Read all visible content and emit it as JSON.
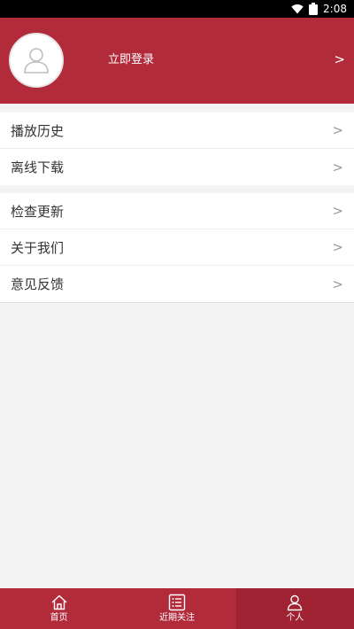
{
  "status_bar": {
    "time": "2:08"
  },
  "profile": {
    "login_label": "立即登录",
    "chevron": ">"
  },
  "menu_group_1": [
    {
      "label": "播放历史",
      "chevron": ">"
    },
    {
      "label": "离线下载",
      "chevron": ">"
    }
  ],
  "menu_group_2": [
    {
      "label": "检查更新",
      "chevron": ">"
    },
    {
      "label": "关于我们",
      "chevron": ">"
    },
    {
      "label": "意见反馈",
      "chevron": ">"
    }
  ],
  "tabs": [
    {
      "label": "首页",
      "icon": "home-icon",
      "active": false
    },
    {
      "label": "近期关注",
      "icon": "list-icon",
      "active": false
    },
    {
      "label": "个人",
      "icon": "person-icon",
      "active": true
    }
  ],
  "colors": {
    "brand": "#b22b3b",
    "brand_dark": "#a02233",
    "background": "#f3f3f3"
  }
}
